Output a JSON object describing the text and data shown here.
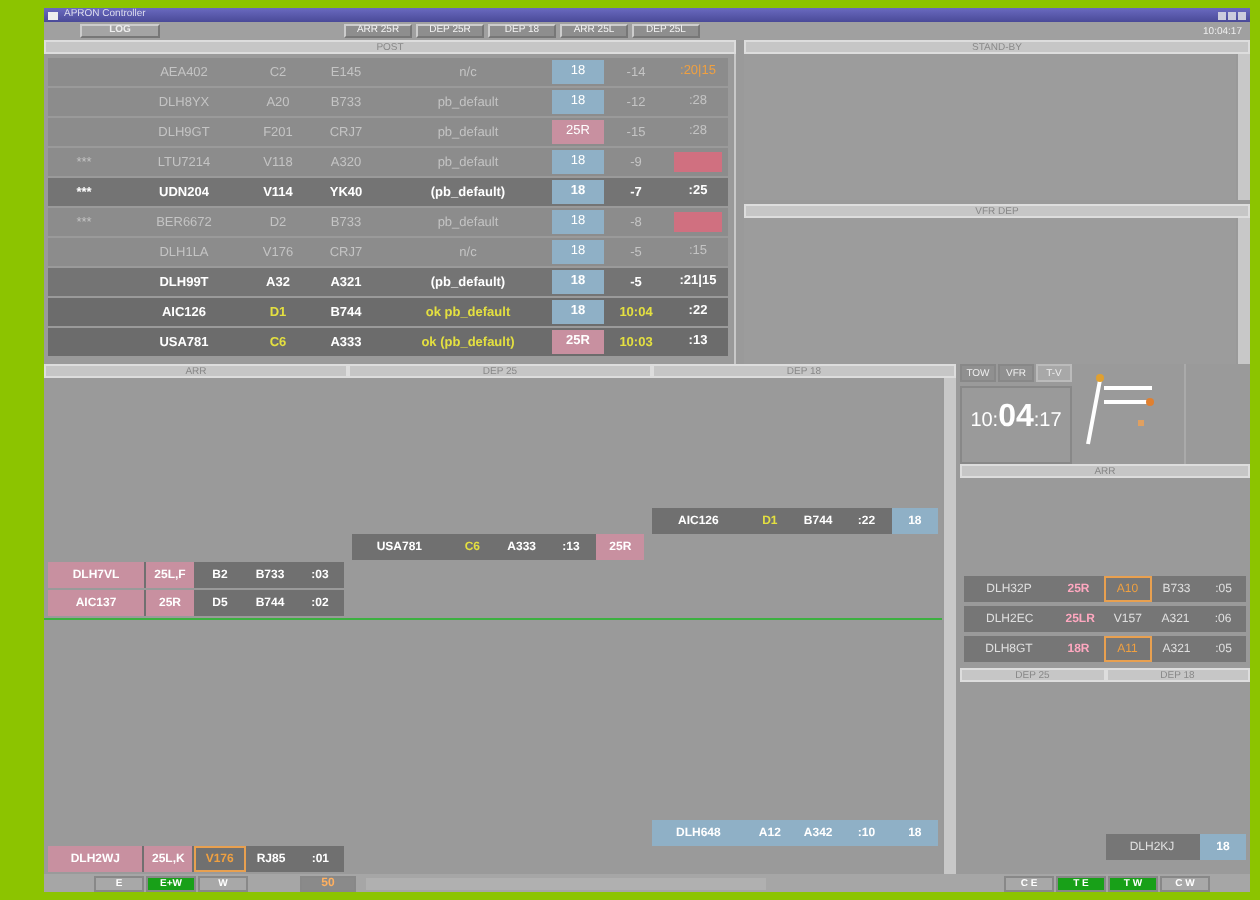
{
  "window": {
    "title": "APRON Controller",
    "clock": "10:04:17"
  },
  "toolbar": {
    "log_button": "LOG",
    "buttons": [
      "ARR 25R",
      "DEP 25R",
      "DEP 18",
      "ARR 25L",
      "DEP 25L"
    ]
  },
  "post": {
    "title": "POST",
    "rows": [
      {
        "kind": "faded",
        "callsign": "AEA402",
        "stand": "C2",
        "type": "E145",
        "procedure": "n/c",
        "runway": {
          "text": "18",
          "color": "#8fb0c6"
        },
        "time": "-14",
        "eta": {
          "text": ":20|15",
          "kind": "warning"
        }
      },
      {
        "kind": "faded",
        "callsign": "DLH8YX",
        "stand": "A20",
        "type": "B733",
        "procedure": "pb_default",
        "runway": {
          "text": "18",
          "color": "#8fb0c6"
        },
        "time": "-12",
        "eta": {
          "text": ":28",
          "kind": "plain"
        }
      },
      {
        "kind": "faded",
        "callsign": "DLH9GT",
        "stand": "F201",
        "type": "CRJ7",
        "procedure": "pb_default",
        "runway": {
          "text": "25R",
          "color": "#c890a0"
        },
        "time": "-15",
        "eta": {
          "text": ":28",
          "kind": "plain"
        }
      },
      {
        "kind": "faded",
        "mark": "***",
        "callsign": "LTU7214",
        "stand": "V118",
        "type": "A320",
        "procedure": "pb_default",
        "runway": {
          "text": "18",
          "color": "#8fb0c6"
        },
        "time": "-9",
        "eta": {
          "kind": "alert"
        }
      },
      {
        "kind": "active",
        "mark": "***",
        "callsign": "UDN204",
        "stand": "V114",
        "type": "YK40",
        "procedure": "(pb_default)",
        "runway": {
          "text": "18",
          "color": "#8fb0c6"
        },
        "time": "-7",
        "eta": {
          "text": ":25",
          "kind": "plain"
        }
      },
      {
        "kind": "faded",
        "mark": "***",
        "callsign": "BER6672",
        "stand": "D2",
        "type": "B733",
        "procedure": "pb_default",
        "runway": {
          "text": "18",
          "color": "#8fb0c6"
        },
        "time": "-8",
        "eta": {
          "kind": "alert"
        }
      },
      {
        "kind": "faded",
        "callsign": "DLH1LA",
        "stand": "V176",
        "type": "CRJ7",
        "procedure": "n/c",
        "runway": {
          "text": "18",
          "color": "#8fb0c6"
        },
        "time": "-5",
        "eta": {
          "text": ":15",
          "kind": "plain"
        }
      },
      {
        "kind": "active",
        "callsign": "DLH99T",
        "stand": "A32",
        "type": "A321",
        "procedure": "(pb_default)",
        "runway": {
          "text": "18",
          "color": "#8fb0c6"
        },
        "time": "-5",
        "eta": {
          "text": ":21|15",
          "kind": "plain"
        }
      },
      {
        "kind": "cleared",
        "callsign": "AIC126",
        "stand": "D1",
        "type": "B744",
        "procedure": "ok pb_default",
        "runway": {
          "text": "18",
          "color": "#8fb0c6"
        },
        "time": "10:04",
        "eta": {
          "text": ":22",
          "kind": "plain"
        }
      },
      {
        "kind": "cleared",
        "callsign": "USA781",
        "stand": "C6",
        "type": "A333",
        "procedure": "ok  (pb_default)",
        "runway": {
          "text": "25R",
          "color": "#c890a0"
        },
        "time": "10:03",
        "eta": {
          "text": ":13",
          "kind": "plain"
        }
      }
    ]
  },
  "standby": {
    "title": "STAND-BY"
  },
  "vfr_dep": {
    "title": "VFR DEP"
  },
  "timeline": {
    "columns": [
      {
        "header": "ARR",
        "strips": [
          {
            "kind": "dark",
            "cells": [
              {
                "text": "DLH7VL",
                "kind": "highlight"
              },
              {
                "text": "25L,F",
                "kind": "highlight"
              },
              {
                "text": "B2",
                "kind": "plain"
              },
              {
                "text": "B733",
                "kind": "plain"
              },
              {
                "text": ":03",
                "kind": "plain"
              }
            ]
          },
          {
            "kind": "dark",
            "cells": [
              {
                "text": "AIC137",
                "kind": "highlight"
              },
              {
                "text": "25R",
                "kind": "highlight"
              },
              {
                "text": "D5",
                "kind": "plain"
              },
              {
                "text": "B744",
                "kind": "plain"
              },
              {
                "text": ":02",
                "kind": "plain"
              }
            ]
          },
          {
            "kind": "dark",
            "cells": [
              {
                "text": "DLH2WJ",
                "kind": "highlight"
              },
              {
                "text": "25L,K",
                "kind": "highlight"
              },
              {
                "text": "V176",
                "kind": "boxed"
              },
              {
                "text": "RJ85",
                "kind": "plain"
              },
              {
                "text": ":01",
                "kind": "plain"
              }
            ]
          }
        ]
      },
      {
        "header": "DEP 25",
        "strips": [
          {
            "kind": "dark",
            "cells": [
              {
                "text": "USA781",
                "kind": "plain"
              },
              {
                "text": "C6",
                "kind": "ready"
              },
              {
                "text": "A333",
                "kind": "plain"
              },
              {
                "text": ":13",
                "kind": "plain"
              },
              {
                "text": "25R",
                "kind": "highlight"
              }
            ]
          }
        ]
      },
      {
        "header": "DEP 18",
        "strips": [
          {
            "kind": "dark",
            "cells": [
              {
                "text": "AIC126",
                "kind": "plain"
              },
              {
                "text": "D1",
                "kind": "ready"
              },
              {
                "text": "B744",
                "kind": "plain"
              },
              {
                "text": ":22",
                "kind": "plain"
              },
              {
                "text": "18",
                "kind": "info"
              }
            ]
          },
          {
            "kind": "info",
            "cells": [
              {
                "text": "DLH648",
                "kind": "plain"
              },
              {
                "text": "A12",
                "kind": "plain"
              },
              {
                "text": "A342",
                "kind": "plain"
              },
              {
                "text": ":10",
                "kind": "plain"
              },
              {
                "text": "18",
                "kind": "plain"
              }
            ]
          }
        ]
      }
    ]
  },
  "tower": {
    "tabs": [
      {
        "label": "TOW",
        "selected": false
      },
      {
        "label": "VFR",
        "selected": false
      },
      {
        "label": "T-V",
        "selected": true
      }
    ],
    "clock": {
      "hours": "10:",
      "minutes": "04",
      "seconds": ":17"
    }
  },
  "arr_panel": {
    "title": "ARR",
    "strips": [
      {
        "kind": "grey",
        "cells": [
          {
            "text": "DLH32P",
            "kind": "plain"
          },
          {
            "text": "25R",
            "kind": "warning"
          },
          {
            "text": "A10",
            "kind": "boxed"
          },
          {
            "text": "B733",
            "kind": "plain"
          },
          {
            "text": ":05",
            "kind": "plain"
          }
        ]
      },
      {
        "kind": "grey",
        "cells": [
          {
            "text": "DLH2EC",
            "kind": "plain"
          },
          {
            "text": "25LR",
            "kind": "warning"
          },
          {
            "text": "V157",
            "kind": "plain"
          },
          {
            "text": "A321",
            "kind": "plain"
          },
          {
            "text": ":06",
            "kind": "plain"
          }
        ]
      },
      {
        "kind": "grey",
        "cells": [
          {
            "text": "DLH8GT",
            "kind": "plain"
          },
          {
            "text": "18R",
            "kind": "warning"
          },
          {
            "text": "A11",
            "kind": "boxed"
          },
          {
            "text": "A321",
            "kind": "plain"
          },
          {
            "text": ":05",
            "kind": "plain"
          }
        ]
      }
    ]
  },
  "dep_panel": {
    "headers": [
      "DEP 25",
      "DEP 18"
    ],
    "strips": [
      {
        "kind": "grey",
        "cells": [
          {
            "text": "DLH2KJ",
            "kind": "plain"
          },
          {
            "text": "18",
            "kind": "info"
          }
        ]
      }
    ]
  },
  "bottom_bar": {
    "left_buttons": [
      {
        "label": "E",
        "selected": false
      },
      {
        "label": "E+W",
        "selected": true
      },
      {
        "label": "W",
        "selected": false
      }
    ],
    "speed": "50",
    "right_buttons": [
      {
        "label": "C E",
        "selected": false
      },
      {
        "label": "T E",
        "selected": true
      },
      {
        "label": "T W",
        "selected": true
      },
      {
        "label": "C W",
        "selected": false
      }
    ]
  }
}
